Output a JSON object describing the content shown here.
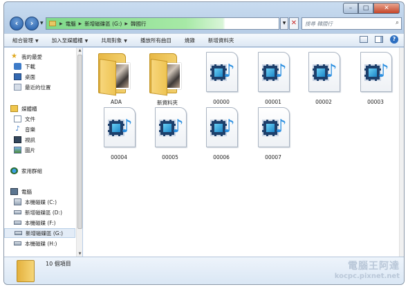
{
  "window": {
    "controls": {
      "minimize": "–",
      "maximize": "□",
      "close": "✕"
    }
  },
  "address": {
    "crumbs": [
      "電腦",
      "新增磁碟區 (G:)",
      "韓國行"
    ],
    "search_placeholder": "搜尋 韓國行"
  },
  "toolbar": {
    "items": [
      {
        "label": "組合管理",
        "dropdown": true
      },
      {
        "label": "加入至媒體櫃",
        "dropdown": true
      },
      {
        "label": "共用對象",
        "dropdown": true
      },
      {
        "label": "播放所有曲目",
        "dropdown": false
      },
      {
        "label": "燒錄",
        "dropdown": false
      },
      {
        "label": "新增資料夾",
        "dropdown": false
      }
    ]
  },
  "navpane": {
    "favorites": "我的最愛",
    "fav_items": [
      "下載",
      "桌面",
      "最近的位置"
    ],
    "libraries": "媒體櫃",
    "lib_items": [
      "文件",
      "音樂",
      "視訊",
      "圖片"
    ],
    "homegroup": "家用群組",
    "computer": "電腦",
    "drives": [
      "本機磁碟 (C:)",
      "新增磁碟區 (D:)",
      "本機磁碟 (F:)",
      "新增磁碟區 (G:)",
      "本機磁碟 (H:)"
    ]
  },
  "content": {
    "items": [
      "ADA",
      "新資料夾",
      "00000",
      "00001",
      "00002",
      "00003",
      "00004",
      "00005",
      "00006",
      "00007"
    ]
  },
  "details": {
    "count_text": "10 個項目"
  },
  "watermark": {
    "line1": "電腦王阿達",
    "line2": "kocpc.pixnet.net"
  },
  "icons": {
    "back": "back-arrow-icon",
    "forward": "forward-arrow-icon",
    "search": "search-icon",
    "folder": "folder-icon",
    "media_file": "media-file-icon"
  },
  "colors": {
    "address_progress": "#7fd98a",
    "window_frame": "#b7cde6",
    "selected_bg": "#e3ecf7"
  }
}
